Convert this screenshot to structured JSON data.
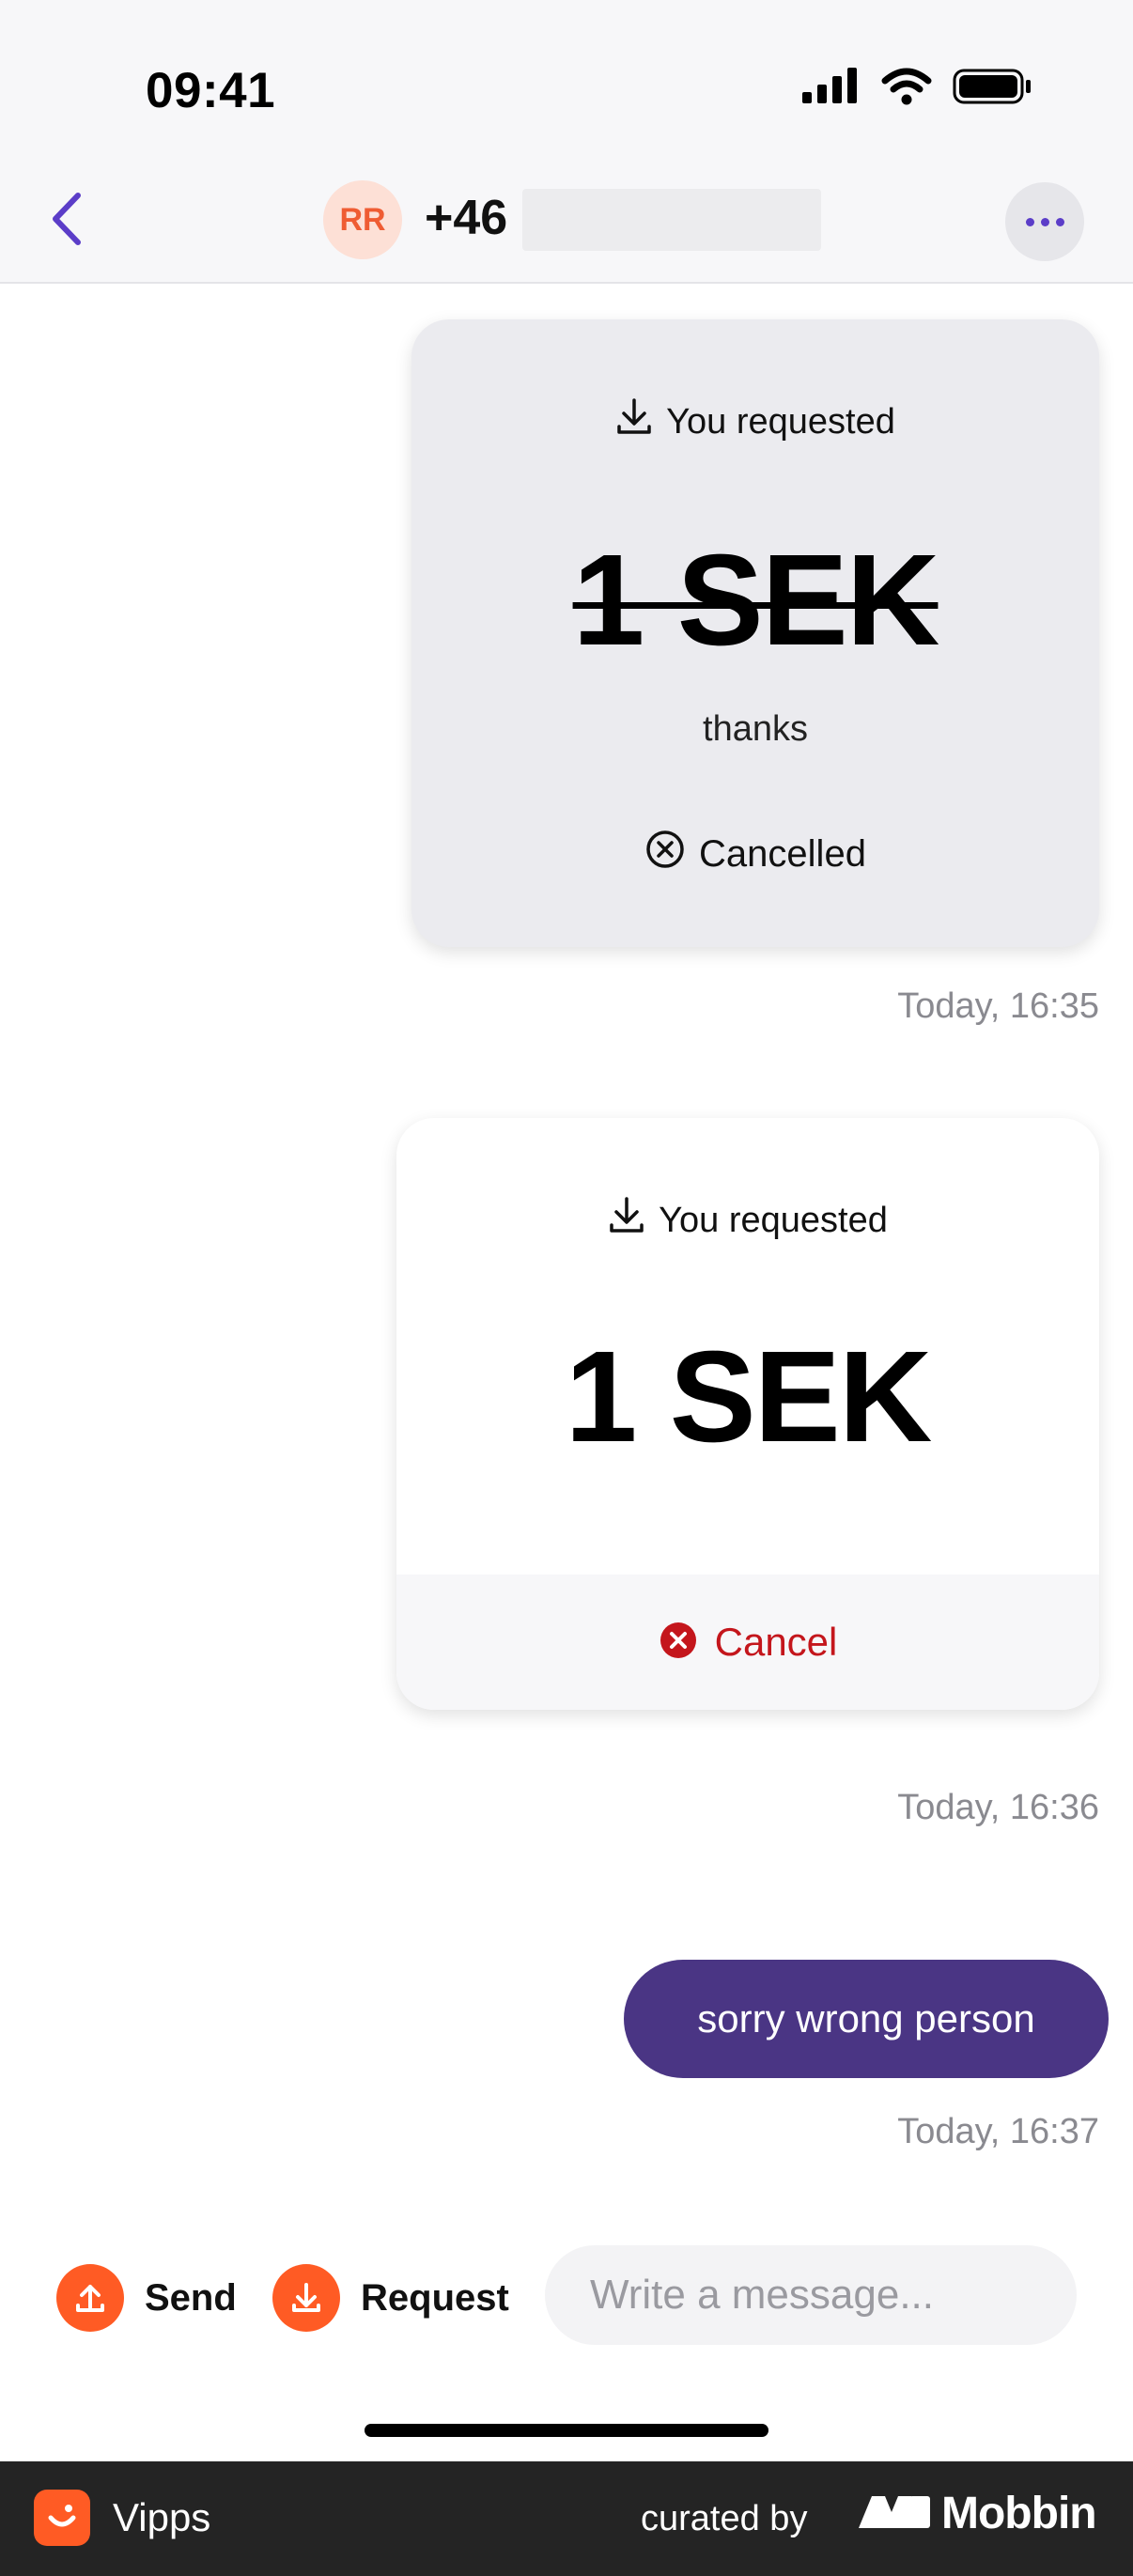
{
  "status_bar": {
    "time": "09:41"
  },
  "header": {
    "avatar_initials": "RR",
    "contact_prefix": "+46"
  },
  "messages": {
    "request_1": {
      "label": "You requested",
      "amount": "1 SEK",
      "note": "thanks",
      "status": "Cancelled",
      "timestamp": "Today, 16:35"
    },
    "request_2": {
      "label": "You requested",
      "amount": "1 SEK",
      "cancel_label": "Cancel",
      "timestamp": "Today, 16:36"
    },
    "text_1": {
      "text": "sorry wrong person",
      "timestamp": "Today, 16:37"
    }
  },
  "composer": {
    "send_label": "Send",
    "request_label": "Request",
    "input_placeholder": "Write a message...",
    "input_value": ""
  },
  "footer": {
    "app_name": "Vipps",
    "curated_by": "curated by",
    "brand": "Mobbin"
  },
  "colors": {
    "accent": "#5b3dc8",
    "vipps_orange": "#ff5b24",
    "bubble": "#4a3584",
    "cancel_red": "#c4161c"
  }
}
